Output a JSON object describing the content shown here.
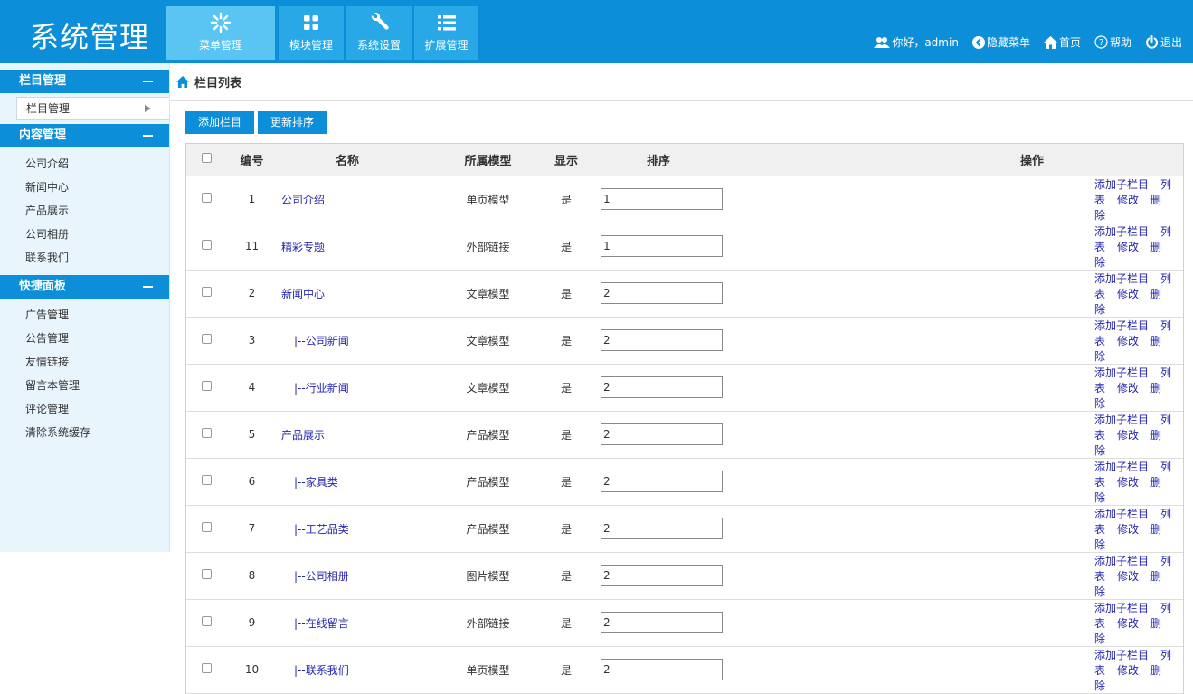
{
  "header": {
    "logo": "系统管理",
    "nav": [
      {
        "label": "菜单管理",
        "icon": "snowflake-icon"
      },
      {
        "label": "模块管理",
        "icon": "grid-icon"
      },
      {
        "label": "系统设置",
        "icon": "wrench-icon"
      },
      {
        "label": "扩展管理",
        "icon": "list-icon"
      }
    ],
    "user": {
      "greeting": "你好，admin",
      "hide_menu": "隐藏菜单",
      "home": "首页",
      "help": "帮助",
      "logout": "退出"
    }
  },
  "sidebar": {
    "groups": [
      {
        "title": "栏目管理",
        "items": [
          "栏目管理"
        ]
      },
      {
        "title": "内容管理",
        "items": [
          "公司介绍",
          "新闻中心",
          "产品展示",
          "公司相册",
          "联系我们"
        ]
      },
      {
        "title": "快捷面板",
        "items": [
          "广告管理",
          "公告管理",
          "友情链接",
          "留言本管理",
          "评论管理",
          "清除系统缓存"
        ]
      }
    ]
  },
  "main": {
    "breadcrumb": "栏目列表",
    "buttons": {
      "add": "添加栏目",
      "sort": "更新排序"
    },
    "table": {
      "headers": {
        "id": "编号",
        "name": "名称",
        "model": "所属模型",
        "show": "显示",
        "order": "排序",
        "ops": "操作"
      },
      "ops": {
        "add_child": "添加子栏目",
        "list": "列表",
        "edit": "修改",
        "delete": "删除"
      },
      "rows": [
        {
          "id": "1",
          "name": "公司介绍",
          "child": false,
          "model": "单页模型",
          "show": "是",
          "order": "1"
        },
        {
          "id": "11",
          "name": "精彩专题",
          "child": false,
          "model": "外部链接",
          "show": "是",
          "order": "1"
        },
        {
          "id": "2",
          "name": "新闻中心",
          "child": false,
          "model": "文章模型",
          "show": "是",
          "order": "2"
        },
        {
          "id": "3",
          "name": "|--公司新闻",
          "child": true,
          "model": "文章模型",
          "show": "是",
          "order": "2"
        },
        {
          "id": "4",
          "name": "|--行业新闻",
          "child": true,
          "model": "文章模型",
          "show": "是",
          "order": "2"
        },
        {
          "id": "5",
          "name": "产品展示",
          "child": false,
          "model": "产品模型",
          "show": "是",
          "order": "2"
        },
        {
          "id": "6",
          "name": "|--家具类",
          "child": true,
          "model": "产品模型",
          "show": "是",
          "order": "2"
        },
        {
          "id": "7",
          "name": "|--工艺品类",
          "child": true,
          "model": "产品模型",
          "show": "是",
          "order": "2"
        },
        {
          "id": "8",
          "name": "|--公司相册",
          "child": true,
          "model": "图片模型",
          "show": "是",
          "order": "2"
        },
        {
          "id": "9",
          "name": "|--在线留言",
          "child": true,
          "model": "外部链接",
          "show": "是",
          "order": "2"
        },
        {
          "id": "10",
          "name": "|--联系我们",
          "child": true,
          "model": "单页模型",
          "show": "是",
          "order": "2"
        }
      ]
    }
  }
}
